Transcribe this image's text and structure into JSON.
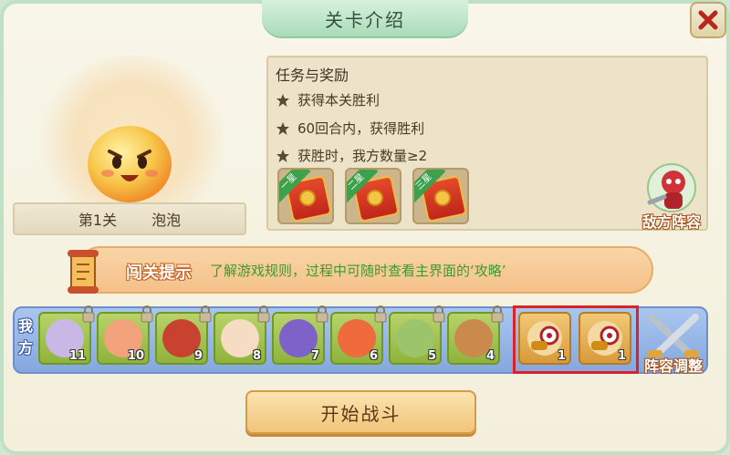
{
  "dialog": {
    "title": "关卡介绍",
    "close_icon": "close-icon"
  },
  "level": {
    "number_label": "第1关",
    "name": "泡泡"
  },
  "mission": {
    "title": "任务与奖励",
    "objectives": [
      "获得本关胜利",
      "60回合内，获得胜利",
      "获胜时，我方数量≥2"
    ],
    "rewards": [
      {
        "tag": "一星"
      },
      {
        "tag": "二星"
      },
      {
        "tag": "三星"
      }
    ]
  },
  "enemy_lineup_label": "敌方阵容",
  "tip": {
    "label": "闯关提示",
    "text": "了解游戏规则，过程中可随时查看主界面的‘攻略’"
  },
  "team": {
    "label": "我方",
    "members": [
      {
        "count": "11",
        "color": "#c9b7e6"
      },
      {
        "count": "10",
        "color": "#f2a37b"
      },
      {
        "count": "9",
        "color": "#c9412f"
      },
      {
        "count": "8",
        "color": "#f6dcc2"
      },
      {
        "count": "7",
        "color": "#7f62c7"
      },
      {
        "count": "6",
        "color": "#ef6a3c"
      },
      {
        "count": "5",
        "color": "#9cc46a"
      },
      {
        "count": "4",
        "color": "#c98a4b"
      }
    ],
    "extra_units": [
      {
        "count": "1"
      },
      {
        "count": "1"
      }
    ],
    "formation_label": "阵容调整"
  },
  "start_button_label": "开始战斗",
  "colors": {
    "accent_green": "#3f9a2c",
    "highlight_red": "#d8232a",
    "panel": "#f3efdb"
  }
}
